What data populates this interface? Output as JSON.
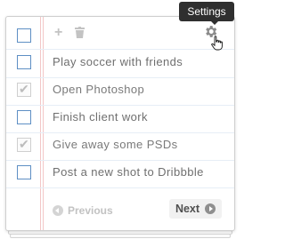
{
  "tooltip": {
    "text": "Settings"
  },
  "toolbar": {
    "add_icon": "plus-icon",
    "delete_icon": "trash-icon",
    "settings_icon": "gear-icon"
  },
  "tasks": [
    {
      "label": "Play soccer with friends",
      "done": false
    },
    {
      "label": "Open Photoshop",
      "done": true
    },
    {
      "label": "Finish client work",
      "done": false
    },
    {
      "label": "Give away some PSDs",
      "done": true
    },
    {
      "label": "Post a new shot to Dribbble",
      "done": false
    }
  ],
  "pagination": {
    "previous_label": "Previous",
    "next_label": "Next"
  },
  "colors": {
    "checkbox_border": "#5e8fc4",
    "margin_line": "#f3c7c7",
    "tooltip_bg": "#2f2f2f"
  }
}
